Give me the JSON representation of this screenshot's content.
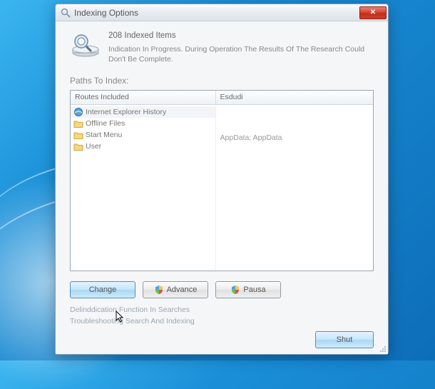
{
  "window": {
    "title": "Indexing Options"
  },
  "summary": {
    "count_text": "208 Indexed Items",
    "status": "Indication In Progress. During Operation The Results Of The Research Could Don't Be Complete."
  },
  "sections": {
    "paths_label": "Paths To Index:"
  },
  "table": {
    "header_col1": "Routes Included",
    "header_col2": "Esdudi",
    "rows": [
      {
        "icon": "ie",
        "label": "Internet Explorer History",
        "selected": true
      },
      {
        "icon": "folder",
        "label": "Offline Files",
        "selected": false
      },
      {
        "icon": "folder",
        "label": "Start Menu",
        "selected": false
      },
      {
        "icon": "folder",
        "label": "User",
        "selected": false
      }
    ],
    "col2_text": "AppData; AppData"
  },
  "buttons": {
    "change": "Change",
    "advance": "Advance",
    "pause": "Pausa",
    "shut": "Shut"
  },
  "links": {
    "deind": "Delinddication Function In Searches",
    "trouble": "Troubleshooting Search And Indexing"
  }
}
